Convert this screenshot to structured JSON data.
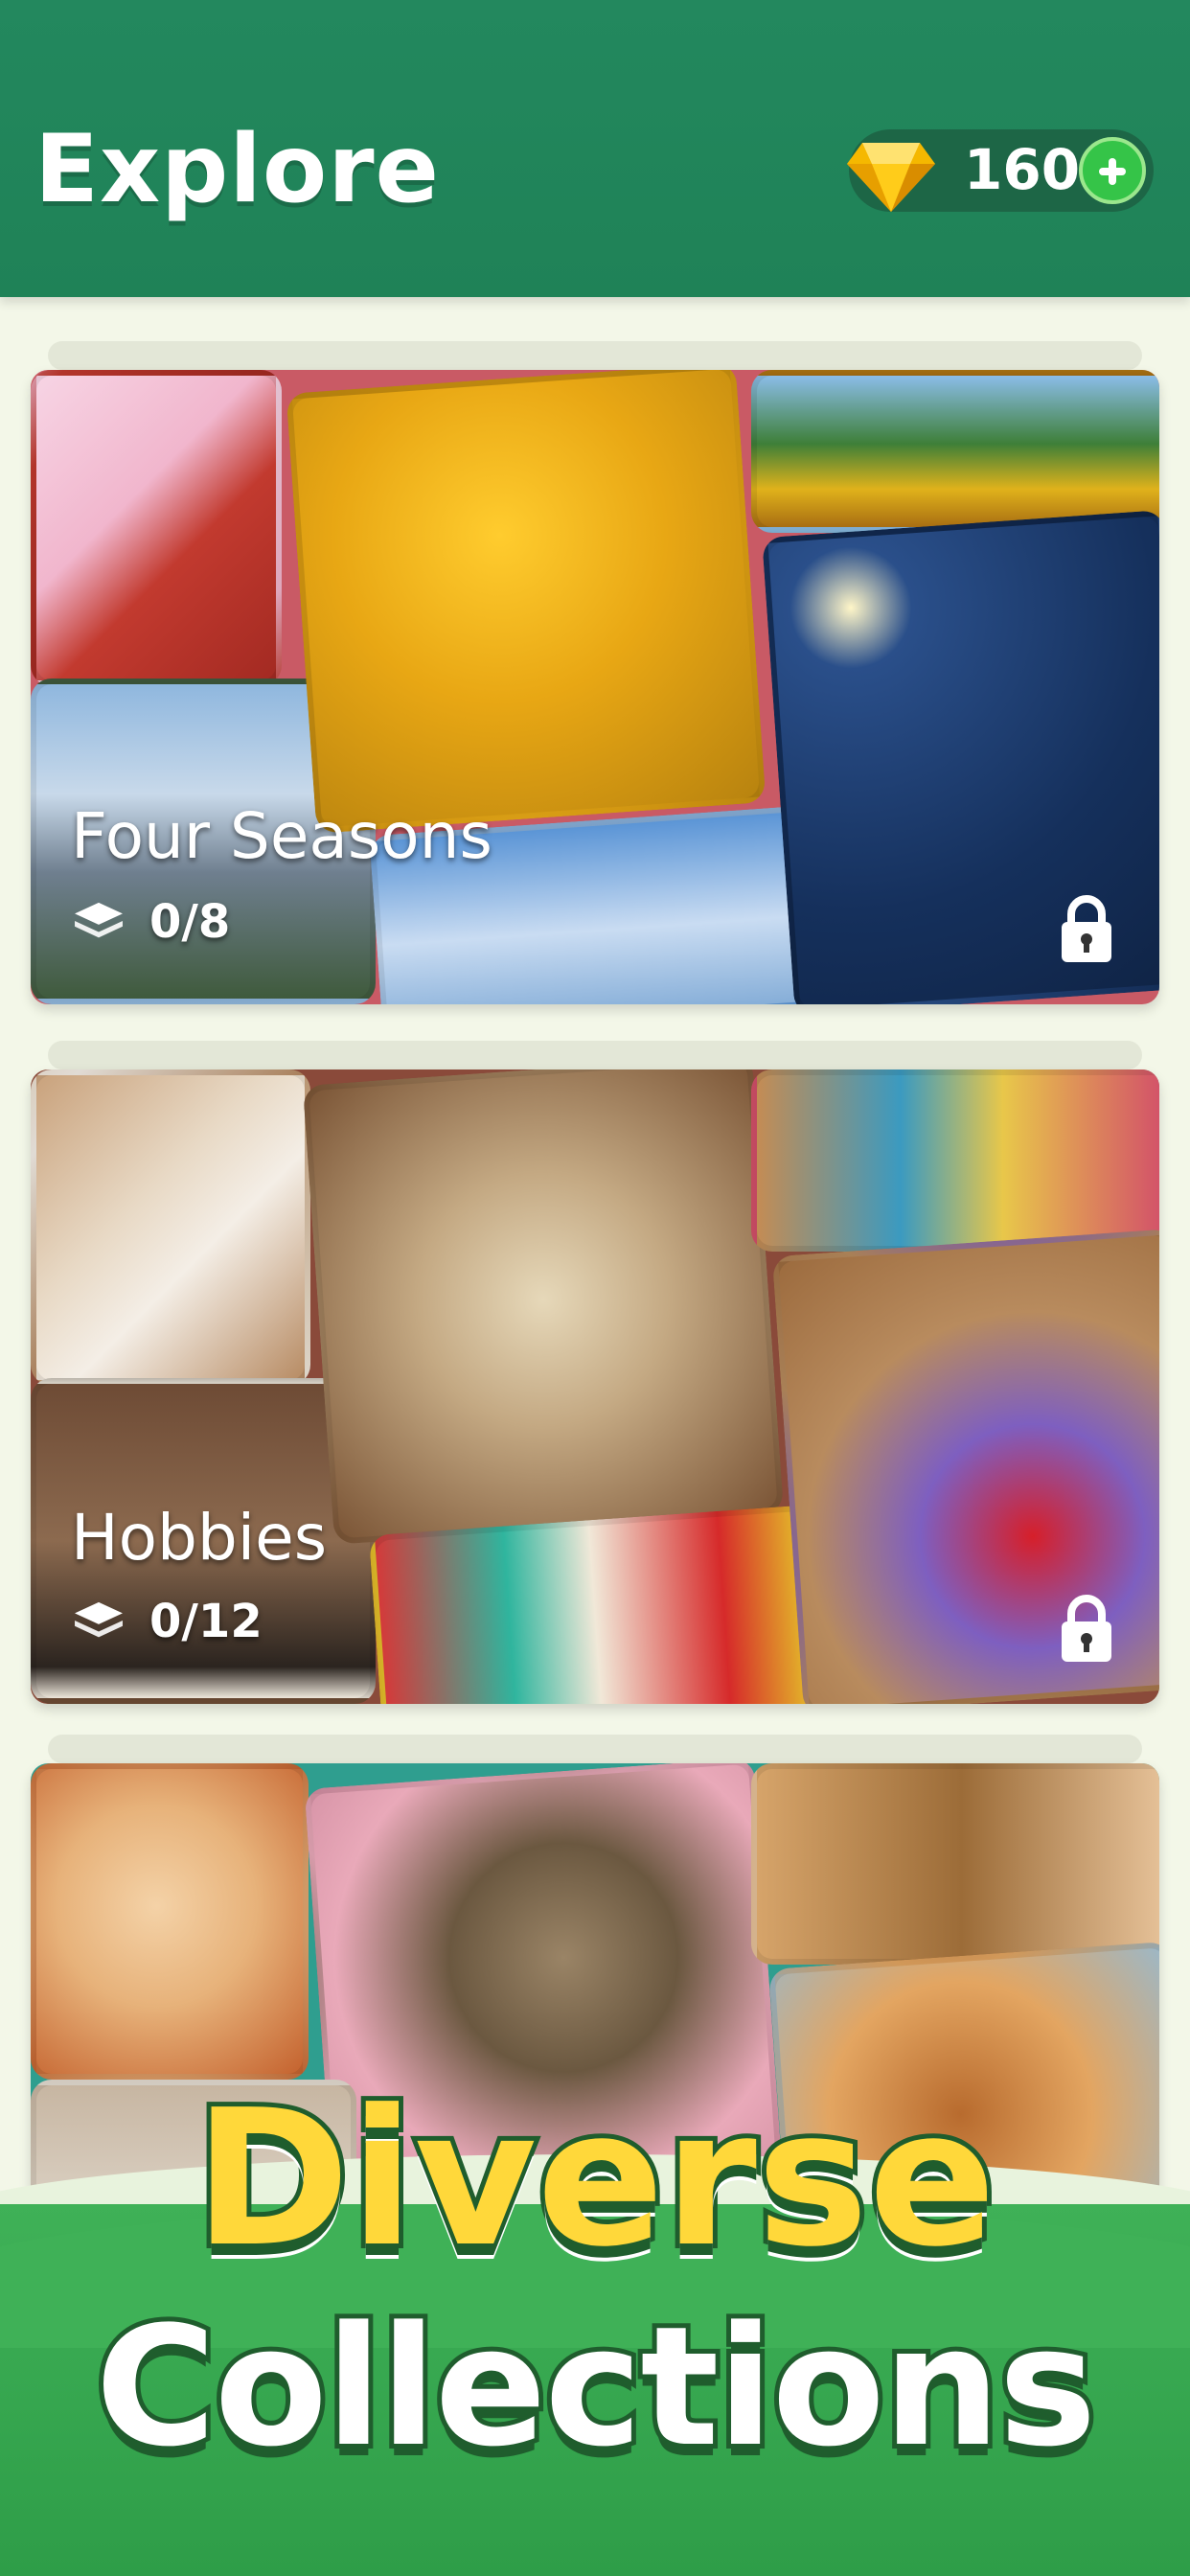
{
  "header": {
    "title": "Explore",
    "gems": "160"
  },
  "collections": [
    {
      "title": "Four Seasons",
      "progress": "0/8",
      "locked": true,
      "frame_color": "#c95a65"
    },
    {
      "title": "Hobbies",
      "progress": "0/12",
      "locked": true,
      "frame_color": "#8a4a3a"
    },
    {
      "title": "",
      "progress": "",
      "locked": false,
      "frame_color": "#2f9e8f"
    }
  ],
  "banner": {
    "line1": "Diverse",
    "line2": "Collections"
  },
  "colors": {
    "header_green": "#1f8257",
    "accent_yellow": "#ffd83a",
    "plus_green": "#35c448"
  },
  "icons": [
    "gem-icon",
    "plus-icon",
    "layers-icon",
    "lock-icon"
  ]
}
